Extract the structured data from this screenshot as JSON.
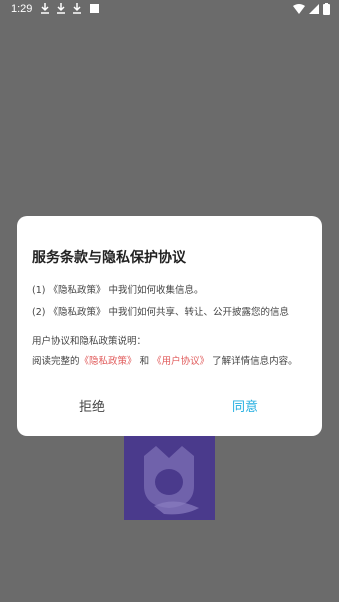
{
  "status": {
    "time": "1:29"
  },
  "dialog": {
    "title": "服务条款与隐私保护协议",
    "line1": "(1) 《隐私政策》 中我们如何收集信息。",
    "line2": "(2) 《隐私政策》 中我们如何共享、转让、公开披露您的信息",
    "section_label": "用户协议和隐私政策说明：",
    "read_prefix": "阅读完整的",
    "privacy_link": "《隐私政策》",
    "and_text": "和",
    "user_link": "《用户协议》",
    "read_suffix": "了解详情信息内容。",
    "reject_label": "拒绝",
    "agree_label": "同意"
  },
  "colors": {
    "link": "#e05a5a",
    "agree": "#22aee0",
    "overlay": "#6b6b6b",
    "logo_bg": "#4a3a8c"
  }
}
